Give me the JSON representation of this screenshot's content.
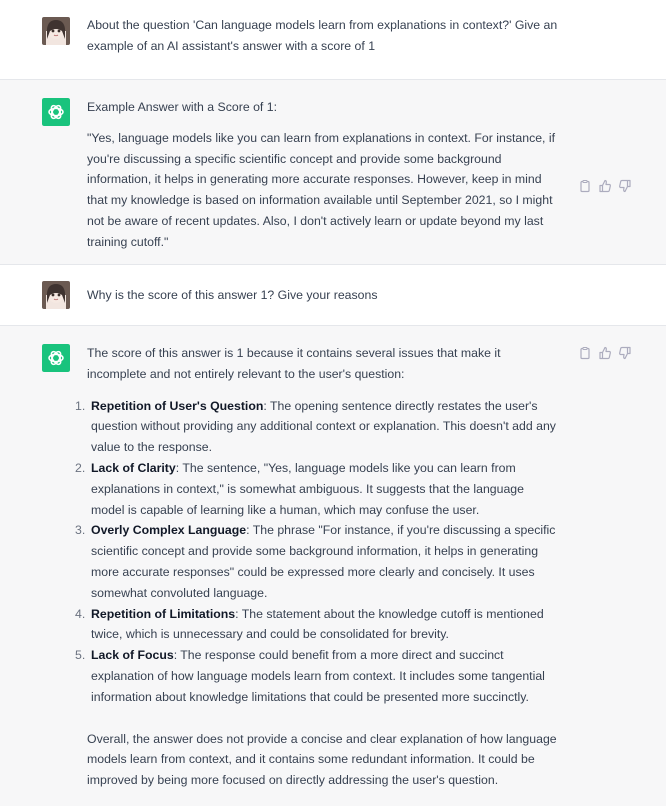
{
  "conversation": [
    {
      "role": "user",
      "text": "About the question 'Can language models learn from explanations in context?' Give an example of an AI assistant's answer with a score of 1"
    },
    {
      "role": "assistant",
      "heading": "Example Answer with a Score of 1:",
      "body": "\"Yes, language models like you can learn from explanations in context. For instance, if you're discussing a specific scientific concept and provide some background information, it helps in generating more accurate responses. However, keep in mind that my knowledge is based on information available until September 2021, so I might not be aware of recent updates. Also, I don't actively learn or update beyond my last training cutoff.\""
    },
    {
      "role": "user",
      "text": "Why is the score of this answer 1? Give your reasons"
    },
    {
      "role": "assistant",
      "intro": "The score of this answer is 1 because it contains several issues that make it incomplete and not entirely relevant to the user's question:",
      "reasons": [
        {
          "num": "1.",
          "title": "Repetition of User's Question",
          "text": ": The opening sentence directly restates the user's question without providing any additional context or explanation. This doesn't add any value to the response."
        },
        {
          "num": "2.",
          "title": "Lack of Clarity",
          "text": ": The sentence, \"Yes, language models like you can learn from explanations in context,\" is somewhat ambiguous. It suggests that the language model is capable of learning like a human, which may confuse the user."
        },
        {
          "num": "3.",
          "title": "Overly Complex Language",
          "text": ": The phrase \"For instance, if you're discussing a specific scientific concept and provide some background information, it helps in generating more accurate responses\" could be expressed more clearly and concisely. It uses somewhat convoluted language."
        },
        {
          "num": "4.",
          "title": "Repetition of Limitations",
          "text": ": The statement about the knowledge cutoff is mentioned twice, which is unnecessary and could be consolidated for brevity."
        },
        {
          "num": "5.",
          "title": "Lack of Focus",
          "text": ": The response could benefit from a more direct and succinct explanation of how language models learn from context. It includes some tangential information about knowledge limitations that could be presented more succinctly."
        }
      ],
      "conclusion": "Overall, the answer does not provide a concise and clear explanation of how language models learn from context, and it contains some redundant information. It could be improved by being more focused on directly addressing the user's question."
    }
  ],
  "icons": {
    "user_avatar": "user-avatar-icon",
    "assistant_avatar": "openai-logo-icon",
    "copy": "clipboard-icon",
    "thumbs_up": "thumbs-up-icon",
    "thumbs_down": "thumbs-down-icon"
  },
  "colors": {
    "assistant_logo_bg": "#19c37d",
    "assistant_row_bg": "#f7f7f8",
    "text": "#374151",
    "icon_gray": "#acacbe"
  }
}
